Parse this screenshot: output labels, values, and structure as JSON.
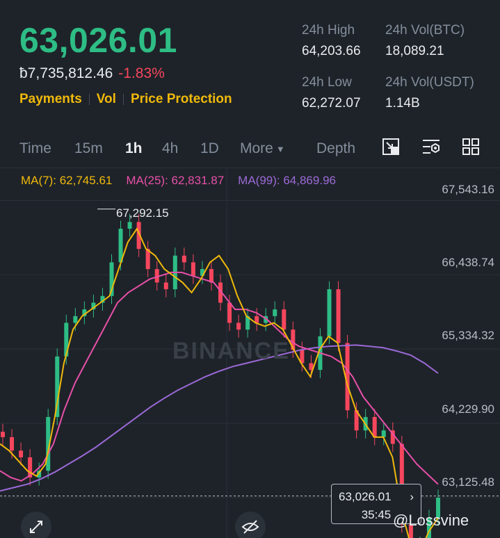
{
  "ticker": {
    "last_price": "63,026.01",
    "fiat_price": "ƀ7,735,812.46",
    "change_pct": "-1.83%",
    "links": [
      "Payments",
      "Vol",
      "Price Protection"
    ]
  },
  "stats": {
    "high_label": "24h High",
    "high_value": "64,203.66",
    "vol_btc_label": "24h Vol(BTC)",
    "vol_btc_value": "18,089.21",
    "low_label": "24h Low",
    "low_value": "62,272.07",
    "vol_usdt_label": "24h Vol(USDT)",
    "vol_usdt_value": "1.14B"
  },
  "timebar": {
    "tabs": [
      "Time",
      "15m",
      "1h",
      "4h",
      "1D"
    ],
    "active": "1h",
    "more": "More",
    "depth": "Depth",
    "icons": [
      "chart-fullscreen-icon",
      "indicator-settings-icon",
      "grid-layout-icon"
    ]
  },
  "ma": {
    "ma7": "MA(7): 62,745.61",
    "ma25": "MA(25): 62,831.87",
    "ma99": "MA(99): 64,869.96"
  },
  "colors": {
    "up": "#2ebd85",
    "down": "#f6465d",
    "ma7": "#f0b90b",
    "ma25": "#e84fa9",
    "ma99": "#9c6ad8"
  },
  "chart_data": {
    "type": "candlestick",
    "y_ticks": [
      "67,543.16",
      "66,438.74",
      "65,334.32",
      "64,229.90",
      "63,125.48"
    ],
    "ylim": [
      62400,
      67900
    ],
    "peak_label": "67,292.15",
    "current_price": "63,026.01",
    "countdown": "35:45",
    "grid": true,
    "ma7": [
      63800,
      63700,
      63550,
      63400,
      63320,
      63500,
      64200,
      65000,
      65500,
      65700,
      65800,
      65900,
      66000,
      66400,
      66800,
      67000,
      66700,
      66600,
      66400,
      66300,
      66200,
      66050,
      66250,
      66500,
      66600,
      66400,
      66000,
      65700,
      65600,
      65550,
      65600,
      65500,
      65250,
      65000,
      64800,
      65200,
      65400,
      65300,
      64700,
      64300,
      64100,
      63900,
      63900,
      63600,
      62800,
      62300,
      62200,
      62500,
      62700
    ],
    "ma25": [
      63400,
      63300,
      63250,
      63350,
      63500,
      63800,
      64300,
      64700,
      65000,
      65300,
      65600,
      65900,
      66050,
      66150,
      66250,
      66300,
      66350,
      66350,
      66300,
      66250,
      66200,
      66000,
      65800,
      65800,
      65750,
      65650,
      65500,
      65350,
      65250,
      65200,
      65150,
      65100,
      65000,
      64800,
      64500,
      64300,
      64100,
      63900,
      63700,
      63500,
      63350,
      63200
    ],
    "ma99": [
      63100,
      63150,
      63200,
      63280,
      63380,
      63500,
      63620,
      63750,
      63900,
      64050,
      64200,
      64350,
      64480,
      64600,
      64700,
      64800,
      64880,
      64950,
      65000,
      65050,
      65100,
      65150,
      65200,
      65230,
      65250,
      65260,
      65270,
      65250,
      65230,
      65180,
      65120,
      65000,
      64850
    ],
    "candles_close": [
      63900,
      63700,
      63600,
      63300,
      63400,
      64200,
      65100,
      65600,
      65700,
      65800,
      65900,
      66000,
      66500,
      67000,
      67100,
      66700,
      66400,
      66200,
      66100,
      66600,
      66500,
      66300,
      66400,
      66200,
      65900,
      65600,
      65500,
      65700,
      65600,
      65700,
      65800,
      65500,
      65200,
      65000,
      64900,
      65400,
      66100,
      65300,
      64300,
      64000,
      64200,
      63900,
      64000,
      63800,
      62600,
      62200,
      62300,
      62700,
      63000
    ]
  },
  "overlay": {
    "watermark": "BINANCE",
    "handle": "@Lossvine"
  }
}
